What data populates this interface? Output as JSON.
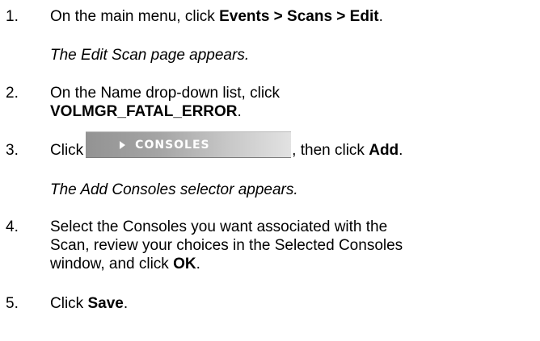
{
  "steps": [
    {
      "number": "1.",
      "text_before": "On the main menu, click ",
      "bold": "Events > Scans > Edit",
      "text_after": ".",
      "result": "The Edit Scan page appears."
    },
    {
      "number": "2.",
      "line1": "On the Name drop-down list, click",
      "bold": "VOLMGR_FATAL_ERROR",
      "text_after": "."
    },
    {
      "number": "3.",
      "text_before": "Click",
      "button_label": "CONSOLES",
      "text_middle": ", then click ",
      "bold": "Add",
      "text_after": ".",
      "result": "The Add Consoles selector appears."
    },
    {
      "number": "4.",
      "line1": "Select the Consoles you want associated with the",
      "line2": "Scan, review your choices in the Selected Consoles",
      "line3_before": "window, and click ",
      "bold": "OK",
      "text_after": "."
    },
    {
      "number": "5.",
      "text_before": "Click ",
      "bold": "Save",
      "text_after": "."
    }
  ],
  "icons": {
    "consoles_button_arrow": "triangle-right-icon"
  }
}
